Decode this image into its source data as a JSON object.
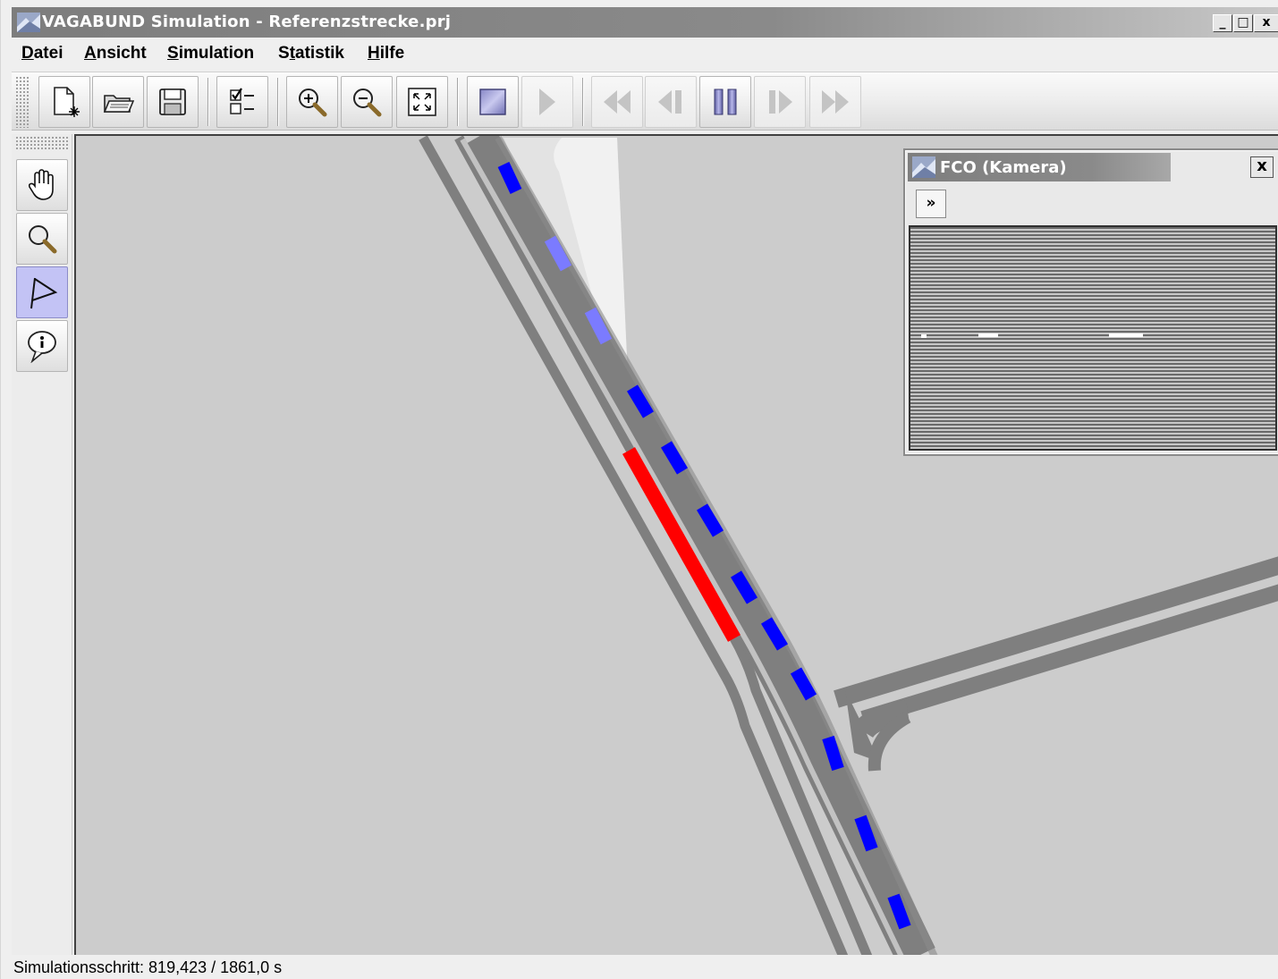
{
  "window": {
    "title": "VAGABUND Simulation - Referenzstrecke.prj",
    "controls": {
      "minimize": "_",
      "maximize": "□",
      "close": "x"
    }
  },
  "menu": {
    "items": [
      {
        "label": "Datei",
        "mnemonic": "D"
      },
      {
        "label": "Ansicht",
        "mnemonic": "A"
      },
      {
        "label": "Simulation",
        "mnemonic": "S"
      },
      {
        "label": "Statistik",
        "mnemonic": "t"
      },
      {
        "label": "Hilfe",
        "mnemonic": "H"
      }
    ]
  },
  "toolbar": {
    "buttons": [
      {
        "icon": "new-document-icon",
        "enabled": true
      },
      {
        "icon": "open-folder-icon",
        "enabled": true
      },
      {
        "icon": "save-disk-icon",
        "enabled": true
      },
      {
        "icon": "checklist-icon",
        "enabled": true
      },
      {
        "icon": "zoom-in-icon",
        "enabled": true
      },
      {
        "icon": "zoom-out-icon",
        "enabled": true
      },
      {
        "icon": "fit-to-window-icon",
        "enabled": true
      },
      {
        "icon": "stop-icon",
        "enabled": true
      },
      {
        "icon": "play-icon",
        "enabled": false
      },
      {
        "icon": "rewind-icon",
        "enabled": false
      },
      {
        "icon": "step-back-icon",
        "enabled": false
      },
      {
        "icon": "pause-icon",
        "enabled": true
      },
      {
        "icon": "step-forward-icon",
        "enabled": false
      },
      {
        "icon": "fast-forward-icon",
        "enabled": false
      }
    ]
  },
  "tools": {
    "buttons": [
      {
        "icon": "hand-pan-icon",
        "active": false
      },
      {
        "icon": "magnifier-icon",
        "active": false
      },
      {
        "icon": "flag-icon",
        "active": true
      },
      {
        "icon": "info-balloon-icon",
        "active": false
      }
    ]
  },
  "map": {
    "background_color": "#cccccc",
    "road_color": "#808080",
    "lane_color": "#c8c8c8",
    "vehicle_colors": {
      "selected": "#ff0000",
      "normal": "#0000ff",
      "fading": "#7b7bff"
    }
  },
  "fco_window": {
    "title": "FCO (Kamera)",
    "close_label": "x",
    "expand_label": "»"
  },
  "statusbar": {
    "text": "Simulationsschritt: 819,423 / 1861,0 s"
  }
}
